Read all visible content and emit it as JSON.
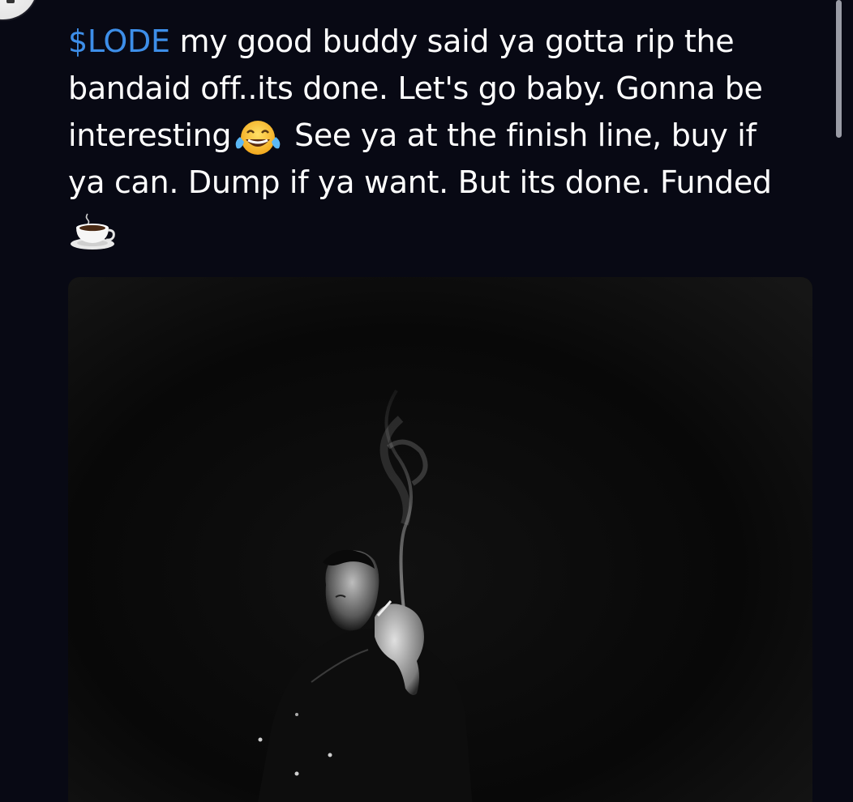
{
  "post": {
    "cashtag": "$LODE",
    "line1_rest": " my good buddy said ya gotta rip the",
    "line2": "bandaid off..its done. Let's go baby. Gonna be",
    "line3_before_emoji": "interesting",
    "line3_after_emoji": " See ya at the finish line, buy if",
    "line4": "ya can. Dump if ya want. But its done.  Funded",
    "emoji_1": "tears-of-joy-emoji",
    "emoji_2": "hot-beverage-emoji"
  },
  "colors": {
    "background": "#080914",
    "text": "#ffffff",
    "cashtag": "#3d8ee8",
    "scrollbar": "#9a9ca6"
  },
  "media": {
    "icon": "photo",
    "description_hidden": true
  }
}
